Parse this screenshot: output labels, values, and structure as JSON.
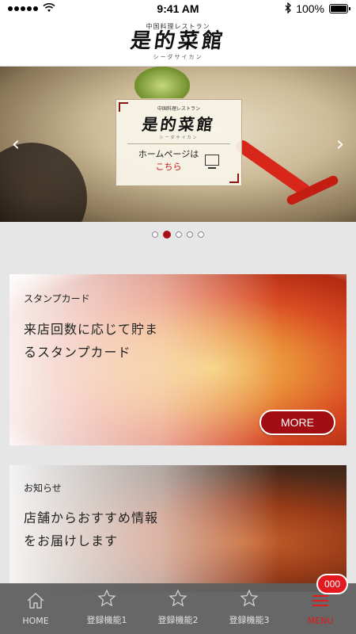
{
  "status_bar": {
    "carrier": "",
    "time": "9:41 AM",
    "battery_text": "100%",
    "battery_level": 1.0
  },
  "header": {
    "logo_sub": "中国料理レストラン",
    "logo_main": "是的菜館",
    "logo_kana": "シーダサイカン"
  },
  "hero": {
    "arrow_left": "‹",
    "arrow_right": "›",
    "card": {
      "logo_sub": "中国料理レストラン",
      "logo_main": "是的菜館",
      "logo_kana": "シーダサイカン",
      "link_line1": "ホームページは",
      "link_line2": "こちら"
    },
    "slide_count": 5,
    "active_slide": 2
  },
  "cards": {
    "stamp": {
      "label": "スタンプカード",
      "desc_line1": "来店回数に応じて貯ま",
      "desc_line2": "るスタンプカード",
      "button": "MORE"
    },
    "news": {
      "label": "お知らせ",
      "desc_line1": "店舗からおすすめ情報",
      "desc_line2": "をお届けします"
    }
  },
  "nav": {
    "home": "HOME",
    "feature1": "登録機能1",
    "feature2": "登録機能2",
    "feature3": "登録機能3",
    "menu": "MENU",
    "badge": "000"
  },
  "colors": {
    "accent": "#a10d12",
    "badge": "#e4181f",
    "nav_bg": "#5f5f5f"
  }
}
